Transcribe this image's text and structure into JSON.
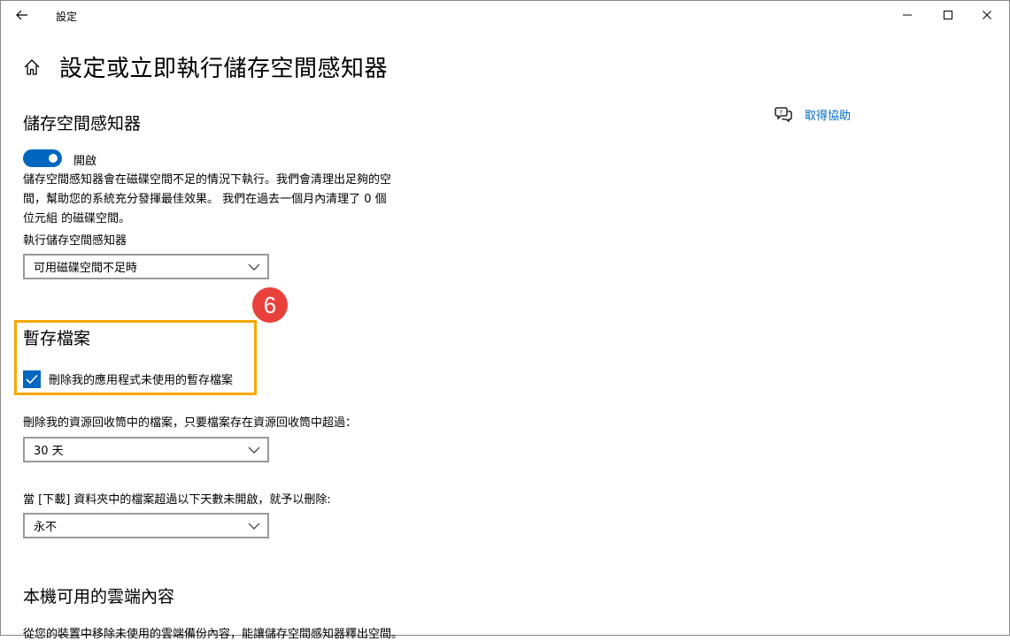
{
  "window": {
    "title": "設定"
  },
  "header": {
    "page_title": "設定或立即執行儲存空間感知器"
  },
  "help": {
    "label": "取得協助"
  },
  "storage_sense": {
    "section_title": "儲存空間感知器",
    "toggle_label": "開啟",
    "toggle_on": true,
    "description_lines": [
      "儲存空間感知器會在磁碟空間不足的情況下執行。我們會清理出足夠的空",
      "間，幫助您的系統充分發揮最佳效果。 我們在過去一個月內清理了 0 個",
      "位元組 的磁碟空間。"
    ],
    "run_label": "執行儲存空間感知器",
    "run_selected": "可用磁碟空間不足時"
  },
  "annotation": {
    "step_number": "6",
    "highlight_color": "#f5a800",
    "badge_color": "#e8413c"
  },
  "temp_files": {
    "section_title": "暫存檔案",
    "checkbox_label": "刪除我的應用程式未使用的暫存檔案",
    "checkbox_checked": true,
    "recycle_label": "刪除我的資源回收筒中的檔案，只要檔案存在資源回收筒中超過：",
    "recycle_selected": "30 天",
    "downloads_label": "當 [下載] 資料夾中的檔案超過以下天數未開啟，就予以刪除:",
    "downloads_selected": "永不"
  },
  "cloud_content": {
    "section_title": "本機可用的雲端內容",
    "description": "從您的裝置中移除未使用的雲端備份內容，能讓儲存空間感知器釋出空間。"
  },
  "colors": {
    "accent": "#0067c0"
  }
}
